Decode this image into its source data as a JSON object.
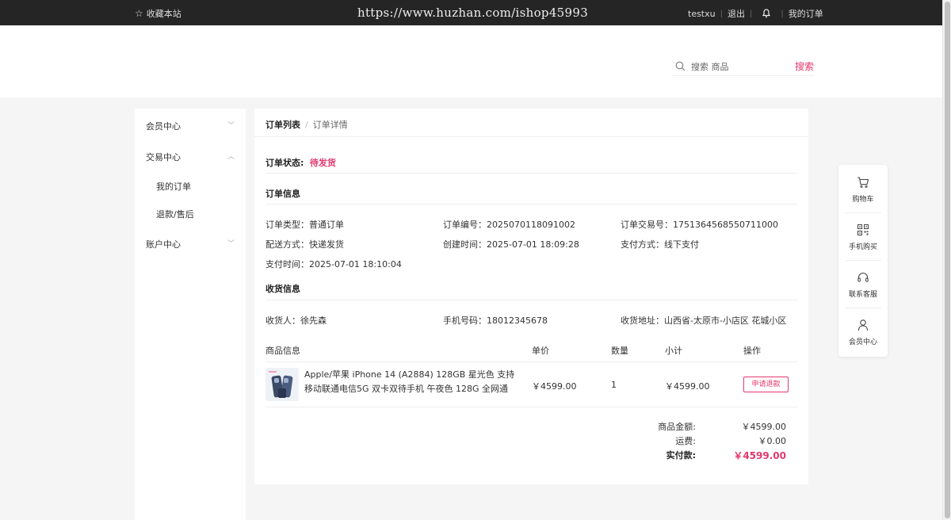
{
  "topbar": {
    "favorite": "收藏本站",
    "url_watermark": "https://www.huzhan.com/ishop45993",
    "username": "testxu",
    "logout": "退出",
    "my_orders": "我的订单"
  },
  "search": {
    "placeholder": "搜索 商品",
    "button": "搜索"
  },
  "sidebar": {
    "items": [
      {
        "label": "会员中心",
        "icon": "chevron-down-icon"
      },
      {
        "label": "交易中心",
        "icon": "chevron-up-icon"
      },
      {
        "label": "账户中心",
        "icon": "chevron-down-icon"
      }
    ],
    "subitems": [
      "我的订单",
      "退款/售后"
    ]
  },
  "breadcrumb": {
    "current": "订单列表",
    "sub": "订单详情"
  },
  "order_status": {
    "label": "订单状态:",
    "value": "待发货"
  },
  "order_info": {
    "title": "订单信息",
    "type": "订单类型：普通订单",
    "number": "订单编号：2025070118091002",
    "trade_number": "订单交易号：1751364568550711000",
    "delivery": "配送方式：快递发货",
    "created": "创建时间：2025-07-01 18:09:28",
    "payment": "支付方式：线下支付",
    "paid_time": "支付时间：2025-07-01 18:10:04"
  },
  "receiver_info": {
    "title": "收货信息",
    "name": "收货人：徐先森",
    "phone": "手机号码：18012345678",
    "address": "收货地址：山西省-太原市-小店区 花城小区"
  },
  "goods_table": {
    "headers": [
      "商品信息",
      "单价",
      "数量",
      "小计",
      "操作"
    ],
    "row": {
      "name": "Apple/苹果 iPhone 14 (A2884) 128GB 星光色 支持移动联通电信5G 双卡双待手机 午夜色 128G 全网通",
      "price": "￥4599.00",
      "qty": "1",
      "subtotal": "￥4599.00",
      "action": "申请退款"
    }
  },
  "summary": {
    "goods_label": "商品金额:",
    "goods_value": "￥4599.00",
    "freight_label": "运费:",
    "freight_value": "￥0.00",
    "paid_label": "实付款:",
    "paid_value": "￥4599.00"
  },
  "floatbar": [
    {
      "label": "购物车",
      "icon": "cart-icon"
    },
    {
      "label": "手机购买",
      "icon": "qrcode-icon"
    },
    {
      "label": "联系客服",
      "icon": "headset-icon"
    },
    {
      "label": "会员中心",
      "icon": "user-icon"
    }
  ],
  "colors": {
    "accent": "#e4386e",
    "topbar_bg": "#252525",
    "page_bg": "#f5f5f5"
  }
}
